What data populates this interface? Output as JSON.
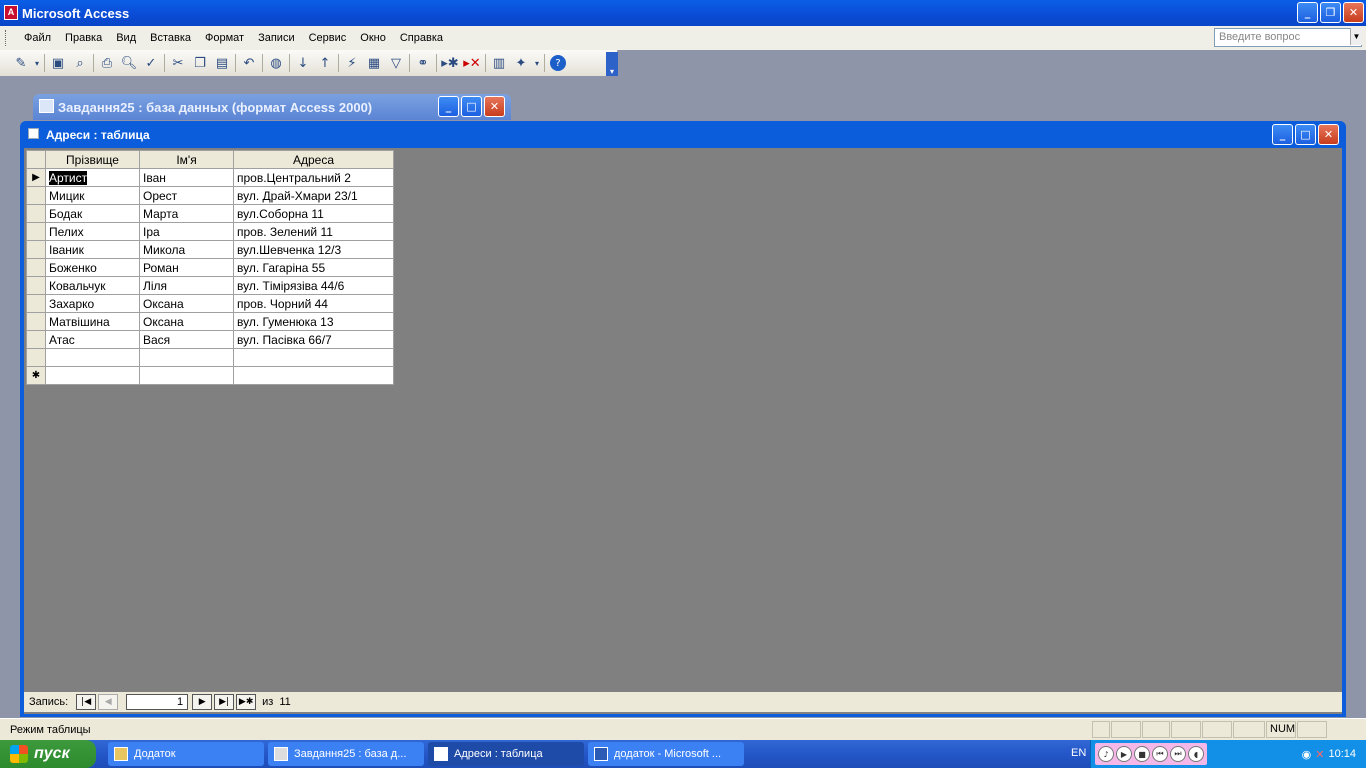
{
  "app": {
    "title": "Microsoft Access",
    "icon": "access-icon"
  },
  "window_buttons": {
    "minimize": "_",
    "maximize": "□",
    "restore": "❐",
    "close": "✕"
  },
  "menu": [
    "Файл",
    "Правка",
    "Вид",
    "Вставка",
    "Формат",
    "Записи",
    "Сервис",
    "Окно",
    "Справка"
  ],
  "ask": {
    "placeholder": "Введите вопрос"
  },
  "toolbar": {
    "buttons": [
      "view-icon",
      "save-icon",
      "search-icon",
      "print-icon",
      "print-preview-icon",
      "spelling-icon",
      "cut-icon",
      "copy-icon",
      "paste-icon",
      "undo-icon",
      "hyperlink-icon",
      "sort-ascending-icon",
      "sort-descending-icon",
      "filter-by-selection-icon",
      "filter-by-form-icon",
      "apply-filter-icon",
      "find-icon",
      "new-record-icon",
      "delete-record-icon",
      "database-window-icon",
      "new-object-icon",
      "help-icon"
    ]
  },
  "db_window": {
    "title": "Завдання25 : база данных (формат Access 2000)"
  },
  "table_window": {
    "title": "Адреси : таблица",
    "columns": [
      "Прізвище",
      "Ім'я",
      "Адреса"
    ],
    "rows": [
      [
        "Артист",
        "Іван",
        "пров.Центральний 2"
      ],
      [
        "Мицик",
        "Орест",
        "вул. Драй-Хмари 23/1"
      ],
      [
        "Бодак",
        "Марта",
        "вул.Соборна 11"
      ],
      [
        "Пелих",
        "Іра",
        "пров. Зелений 11"
      ],
      [
        "Іваник",
        "Микола",
        "вул.Шевченка 12/3"
      ],
      [
        "Боженко",
        "Роман",
        "вул. Гагаріна 55"
      ],
      [
        "Ковальчук",
        "Ліля",
        "вул. Тімірязіва 44/6"
      ],
      [
        "Захарко",
        "Оксана",
        "пров. Чорний 44"
      ],
      [
        "Матвішина",
        "Оксана",
        "вул. Гуменюка 13"
      ],
      [
        "Атас",
        "Вася",
        "вул. Пасівка 66/7"
      ],
      [
        "",
        "",
        ""
      ]
    ],
    "current_marker": "▶",
    "new_marker": "✱"
  },
  "navigator": {
    "label": "Запись:",
    "current": "1",
    "of_label": "из",
    "total": "11"
  },
  "status": {
    "mode": "Режим таблицы",
    "num": "NUM"
  },
  "taskbar": {
    "start": "пуск",
    "tasks": [
      "Додаток",
      "Завдання25 : база д...",
      "Адреси : таблица",
      "додаток - Microsoft ..."
    ],
    "lang": "EN",
    "time": "10:14"
  }
}
